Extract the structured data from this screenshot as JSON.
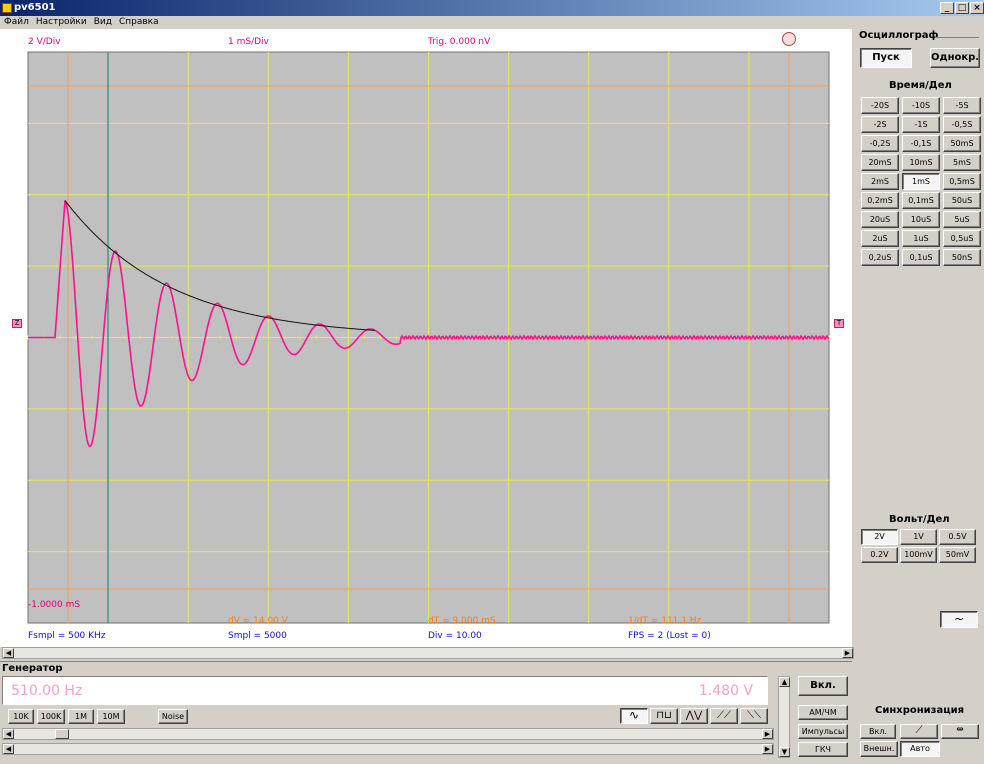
{
  "window": {
    "title": "pv6501",
    "controls": [
      "_",
      "□",
      "×"
    ]
  },
  "menu": [
    "Файл",
    "Настройки",
    "Вид",
    "Справка"
  ],
  "scope": {
    "top": {
      "volts": "2 V/Div",
      "time": "1 mS/Div",
      "trig": "Trig. 0.000 nV"
    },
    "bottom": {
      "offset": "-1.0000 mS",
      "dv": "dV = 14.00 V",
      "dt": "dT = 9.000 mS",
      "freq": "1/dT = 111.1 Hz",
      "fsmpl": "Fsmpl = 500 KHz",
      "smpl": "Smpl = 5000",
      "div": "Div = 10.00",
      "fps": "FPS = 2 (Lost = 0)"
    },
    "marker_left": "Z",
    "marker_right": "T",
    "colors": {
      "plot_bg": "#c0c0c0",
      "grid": "#e8e85a",
      "grid_border": "#f0a060",
      "cursor_v": "#2a8a7a",
      "trace": "#ff1090",
      "envelope": "#101010"
    }
  },
  "panel": {
    "oscillo_title": "Осциллограф",
    "start": "Пуск",
    "single": "Однокр.",
    "time_title": "Время/Дел",
    "time_buttons": [
      "-20S",
      "-10S",
      "-5S",
      "-2S",
      "-1S",
      "-0,5S",
      "-0,2S",
      "-0,1S",
      "50mS",
      "20mS",
      "10mS",
      "5mS",
      "2mS",
      "1mS",
      "0,5mS",
      "0,2mS",
      "0,1mS",
      "50uS",
      "20uS",
      "10uS",
      "5uS",
      "2uS",
      "1uS",
      "0,5uS",
      "0,2uS",
      "0,1uS",
      "50nS"
    ],
    "time_selected": "1mS",
    "volt_title": "Вольт/Дел",
    "volt_buttons": [
      "2V",
      "1V",
      "0.5V",
      "0.2V",
      "100mV",
      "50mV"
    ],
    "volt_selected": "2V",
    "coupling_symbol": "~",
    "sync_title": "Синхронизация",
    "sync_on": "Вкл.",
    "sync_ext": "Внешн.",
    "sync_auto": "Авто"
  },
  "generator": {
    "title": "Генератор",
    "freq": "510.00 Hz",
    "ampl": "1.480 V",
    "ranges": [
      "10K",
      "100K",
      "1M",
      "10M"
    ],
    "noise": "Noise",
    "on": "Вкл.",
    "amfm": "АМ/ЧМ",
    "pulses": "Импульсы",
    "gkch": "ГКЧ",
    "waves": [
      "sine-icon",
      "square-icon",
      "triangle-icon",
      "sawtooth-icon",
      "reverse-sawtooth-icon"
    ]
  }
}
